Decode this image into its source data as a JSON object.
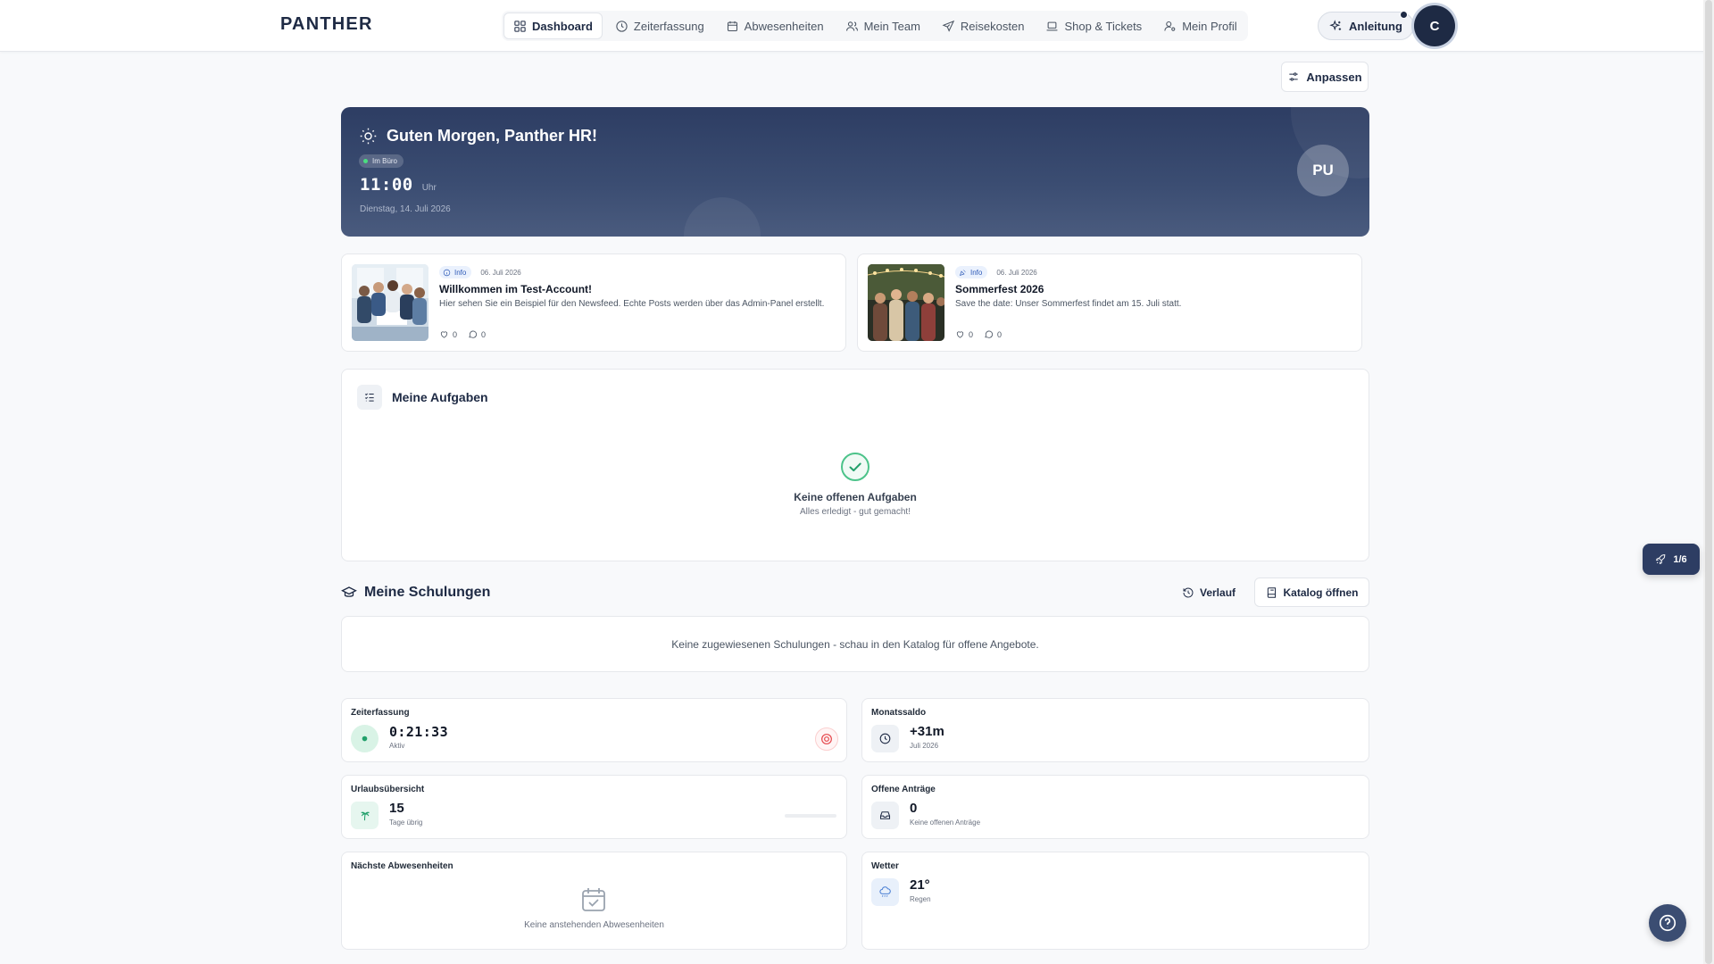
{
  "brand": "PANTHER",
  "nav": [
    {
      "label": "Dashboard",
      "icon": "grid-icon",
      "active": true
    },
    {
      "label": "Zeiterfassung",
      "icon": "clock-icon"
    },
    {
      "label": "Abwesenheiten",
      "icon": "calendar-icon"
    },
    {
      "label": "Mein Team",
      "icon": "users-icon"
    },
    {
      "label": "Reisekosten",
      "icon": "plane-icon"
    },
    {
      "label": "Shop & Tickets",
      "icon": "laptop-icon"
    },
    {
      "label": "Mein Profil",
      "icon": "user-gear-icon"
    }
  ],
  "header": {
    "guide_label": "Anleitung",
    "avatar_initial": "C"
  },
  "customize_label": "Anpassen",
  "hero": {
    "greeting": "Guten Morgen, Panther HR!",
    "status": "Im Büro",
    "time": "11:00",
    "time_unit": "Uhr",
    "date": "Dienstag, 14. Juli 2026",
    "avatar_initials": "PU"
  },
  "news": [
    {
      "tag": "Info",
      "date": "06. Juli 2026",
      "title": "Willkommen im Test-Account!",
      "text": "Hier sehen Sie ein Beispiel für den Newsfeed. Echte Posts werden über das Admin-Panel erstellt.",
      "likes": "0",
      "comments": "0"
    },
    {
      "tag": "Info",
      "date": "06. Juli 2026",
      "title": "Sommerfest 2026",
      "text": "Save the date: Unser Sommerfest findet am 15. Juli statt.",
      "likes": "0",
      "comments": "0"
    }
  ],
  "tasks": {
    "title": "Meine Aufgaben",
    "empty_title": "Keine offenen Aufgaben",
    "empty_sub": "Alles erledigt - gut gemacht!"
  },
  "trainings": {
    "title": "Meine Schulungen",
    "history_label": "Verlauf",
    "catalog_label": "Katalog öffnen",
    "empty": "Keine zugewiesenen Schulungen - schau in den Katalog für offene Angebote."
  },
  "widgets": {
    "time": {
      "label": "Zeiterfassung",
      "value": "0:21:33",
      "sub": "Aktiv"
    },
    "balance": {
      "label": "Monatssaldo",
      "value": "+31m",
      "sub": "Juli 2026"
    },
    "vacation": {
      "label": "Urlaubsübersicht",
      "value": "15",
      "sub": "Tage übrig",
      "used_fraction": 0.0
    },
    "requests": {
      "label": "Offene Anträge",
      "value": "0",
      "sub": "Keine offenen Anträge"
    },
    "absences": {
      "label": "Nächste Abwesenheiten",
      "empty": "Keine anstehenden Abwesenheiten"
    },
    "weather": {
      "label": "Wetter",
      "value": "21°",
      "sub": "Regen"
    }
  },
  "tour": {
    "label": "1/6"
  },
  "colors": {
    "primary": "#1e2a44",
    "accent_green": "#22a06b",
    "danger": "#e5484d"
  }
}
